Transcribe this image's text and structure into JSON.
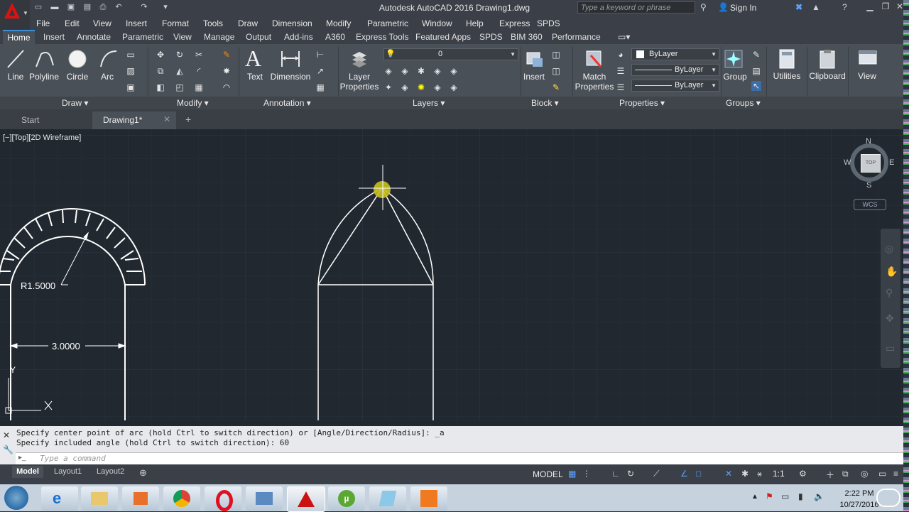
{
  "title": "Autodesk AutoCAD 2016    Drawing1.dwg",
  "search_placeholder": "Type a keyword or phrase",
  "sign_in": "Sign In",
  "menus": [
    "File",
    "Edit",
    "View",
    "Insert",
    "Format",
    "Tools",
    "Draw",
    "Dimension",
    "Modify",
    "Parametric",
    "Window",
    "Help",
    "Express",
    "SPDS"
  ],
  "ribbon_tabs": [
    "Home",
    "Insert",
    "Annotate",
    "Parametric",
    "View",
    "Manage",
    "Output",
    "Add-ins",
    "A360",
    "Express Tools",
    "Featured Apps",
    "SPDS",
    "BIM 360",
    "Performance"
  ],
  "draw_tools": [
    "Line",
    "Polyline",
    "Circle",
    "Arc"
  ],
  "annotation_tools": [
    "Text",
    "Dimension"
  ],
  "layer_tools": {
    "label": "Layer\nProperties",
    "current_layer": "0"
  },
  "block_tools": [
    "Insert"
  ],
  "properties_tools": {
    "match": "Match\nProperties",
    "color": "ByLayer",
    "linetype": "ByLayer",
    "lineweight": "ByLayer"
  },
  "group_tool": "Group",
  "right_tools": [
    "Utilities",
    "Clipboard",
    "View"
  ],
  "panels": [
    "Draw",
    "Modify",
    "Annotation",
    "Layers",
    "Block",
    "Properties",
    "Groups"
  ],
  "file_tabs": {
    "start": "Start",
    "drawing": "Drawing1*"
  },
  "viewport_label": "[−][Top][2D Wireframe]",
  "viewcube": {
    "n": "N",
    "s": "S",
    "e": "E",
    "w": "W",
    "face": "TOP",
    "wcs": "WCS"
  },
  "drawing": {
    "radius_dim": "R1.5000",
    "width_dim": "3.0000",
    "ucs_x": "X",
    "ucs_y": "Y"
  },
  "command_history": [
    "Specify center point of arc (hold Ctrl to switch direction) or [Angle/Direction/Radius]: _a",
    "Specify included angle (hold Ctrl to switch direction): 60"
  ],
  "command_placeholder": "Type a command",
  "layout_tabs": [
    "Model",
    "Layout1",
    "Layout2"
  ],
  "status": {
    "model": "MODEL",
    "scale": "1:1"
  },
  "clock": {
    "time": "2:22 PM",
    "date": "10/27/2016"
  },
  "colors": {
    "accent": "#3b8ed8",
    "logo_red": "#d11",
    "background": "#212830"
  }
}
